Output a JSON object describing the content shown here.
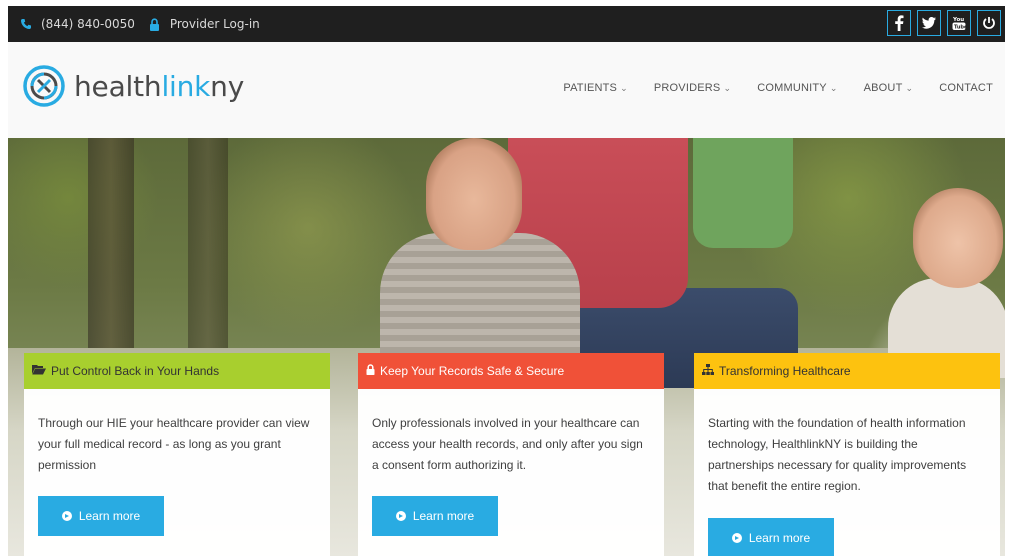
{
  "colors": {
    "accent": "#29abe2",
    "topbar_bg": "#1f1f1f",
    "card1_header": "#a8cf2e",
    "card2_header": "#f05138",
    "card3_header": "#fdc20f"
  },
  "topbar": {
    "phone_icon": "phone-icon",
    "phone": "(844) 840-0050",
    "lock_icon": "lock-icon",
    "provider_login": "Provider Log-in",
    "social": [
      {
        "icon": "facebook-icon",
        "glyph": "f"
      },
      {
        "icon": "twitter-icon",
        "glyph": "t"
      },
      {
        "icon": "youtube-icon",
        "glyph": "You"
      },
      {
        "icon": "power-icon",
        "glyph": "⏻"
      }
    ]
  },
  "header": {
    "logo": {
      "part1": "health",
      "part2": "link",
      "part3": "ny"
    },
    "nav": [
      {
        "label": "PATIENTS",
        "has_dropdown": true
      },
      {
        "label": "PROVIDERS",
        "has_dropdown": true
      },
      {
        "label": "COMMUNITY",
        "has_dropdown": true
      },
      {
        "label": "ABOUT",
        "has_dropdown": true
      },
      {
        "label": "CONTACT",
        "has_dropdown": false
      }
    ]
  },
  "cards": [
    {
      "icon": "folder-open-icon",
      "title": "Put Control Back in Your Hands",
      "text": "Through our HIE your healthcare provider can view your full medical record - as long as you grant permission",
      "button": "Learn more"
    },
    {
      "icon": "lock-icon",
      "title": "Keep Your Records Safe & Secure",
      "text": "Only professionals involved in your healthcare can access your health records, and only after you sign a consent form authorizing it.",
      "button": "Learn more"
    },
    {
      "icon": "sitemap-icon",
      "title": "Transforming Healthcare",
      "text": "Starting with the foundation of health information technology, HealthlinkNY is building the partnerships necessary for quality improvements that benefit the entire region.",
      "button": "Learn more"
    }
  ]
}
